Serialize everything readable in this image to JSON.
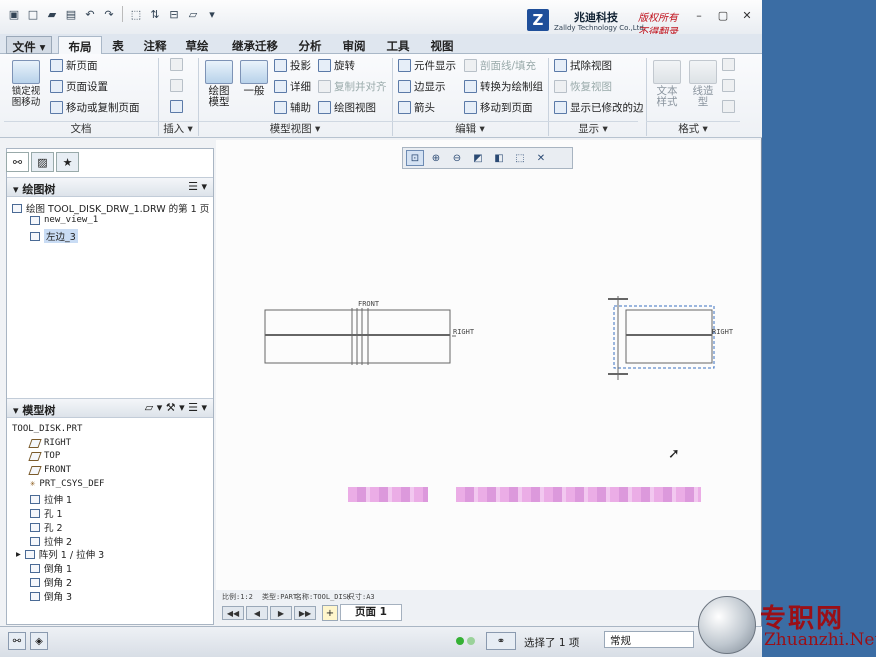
{
  "window": {
    "logo_cn": "兆迪科技",
    "logo_en": "Zalldy Technology Co.,Ltd.",
    "red1": "版权所有",
    "red2": "不得翻录"
  },
  "menu": {
    "tabs": [
      "文件",
      "布局",
      "表",
      "注释",
      "草绘",
      "继承迁移",
      "分析",
      "审阅",
      "工具",
      "视图"
    ],
    "active": "布局"
  },
  "ribbon": {
    "doc": {
      "lock": "锁定视\n图移动",
      "new_page": "新页面",
      "page_setup": "页面设置",
      "move_copy": "移动或复制页面",
      "label": "文档"
    },
    "insert": {
      "label": "插入"
    },
    "model_views": {
      "drawing_model": "绘图\n模型",
      "general": "一般",
      "projection": "投影",
      "detail": "详细",
      "auxiliary": "辅助",
      "revolve": "旋转",
      "copy_align": "复制并对齐",
      "drawing_view": "绘图视图",
      "label": "模型视图"
    },
    "edit": {
      "element_display": "元件显示",
      "section_fill": "剖面线/填充",
      "edge_display": "边显示",
      "convert": "转换为绘制组",
      "arrow": "箭头",
      "move_to_page": "移动到页面",
      "label": "编辑"
    },
    "display": {
      "erase_view": "拭除视图",
      "restore_view": "恢复视图",
      "show_modified": "显示已修改的边",
      "label": "显示"
    },
    "format": {
      "text_style": "文本\n样式",
      "line_style": "线造\n型",
      "label": "格式"
    }
  },
  "drawing_tree": {
    "header": "绘图树",
    "root": "绘图 TOOL_DISK_DRW_1.DRW 的第 1 页",
    "items": [
      "new_view_1",
      "左边_3"
    ]
  },
  "model_tree": {
    "header": "模型树",
    "root": "TOOL_DISK.PRT",
    "items": [
      "RIGHT",
      "TOP",
      "FRONT",
      "PRT_CSYS_DEF",
      "拉伸 1",
      "孔 1",
      "孔 2",
      "拉伸 2",
      "阵列 1 / 拉伸 3",
      "倒角 1",
      "倒角 2",
      "倒角 3"
    ]
  },
  "canvas": {
    "label_front": "FRONT",
    "label_right1": "RIGHT",
    "label_right2": "RIGHT",
    "info1": "比例:1:2",
    "info2": "类型:PART",
    "info3": "名称:TOOL_DISK",
    "info4": "尺寸:A3"
  },
  "pages": {
    "tab": "页面 1"
  },
  "status": {
    "selected": "选择了 1 项",
    "filter": "常规"
  },
  "watermark": {
    "cn": "专职网",
    "en": "Zhuanzhi.Net"
  }
}
